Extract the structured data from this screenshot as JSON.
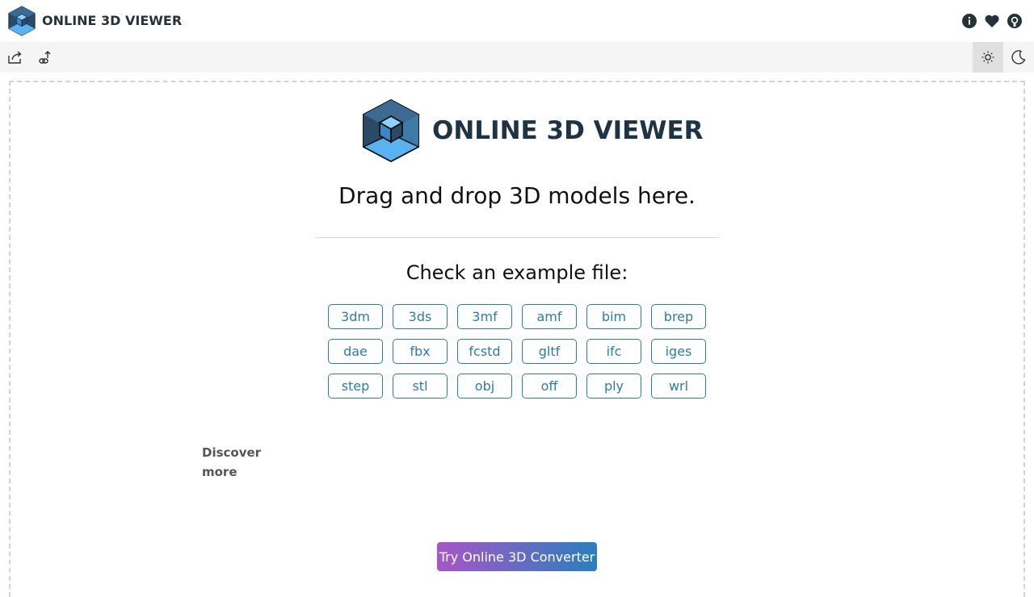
{
  "header": {
    "title": "ONLINE 3D VIEWER",
    "icons": [
      "info-icon",
      "heart-icon",
      "github-icon"
    ]
  },
  "toolbar": {
    "left_icons": [
      "open-file-icon",
      "open-url-icon"
    ],
    "right_icons": [
      "light-mode-icon",
      "dark-mode-icon"
    ],
    "active": "light-mode-icon"
  },
  "intro": {
    "title": "ONLINE 3D VIEWER",
    "drag_text": "Drag and drop 3D models here.",
    "check_text": "Check an example file:",
    "examples": [
      "3dm",
      "3ds",
      "3mf",
      "amf",
      "bim",
      "brep",
      "dae",
      "fbx",
      "fcstd",
      "gltf",
      "ifc",
      "iges",
      "step",
      "stl",
      "obj",
      "off",
      "ply",
      "wrl"
    ],
    "discover_more": "Discover more",
    "converter_button": "Try Online 3D Converter"
  },
  "colors": {
    "accent": "#2a7ea5",
    "logo_dark": "#2b4a66",
    "logo_light": "#5ab3f0",
    "gradient_start": "#a855c7",
    "gradient_end": "#2a7fbd"
  }
}
